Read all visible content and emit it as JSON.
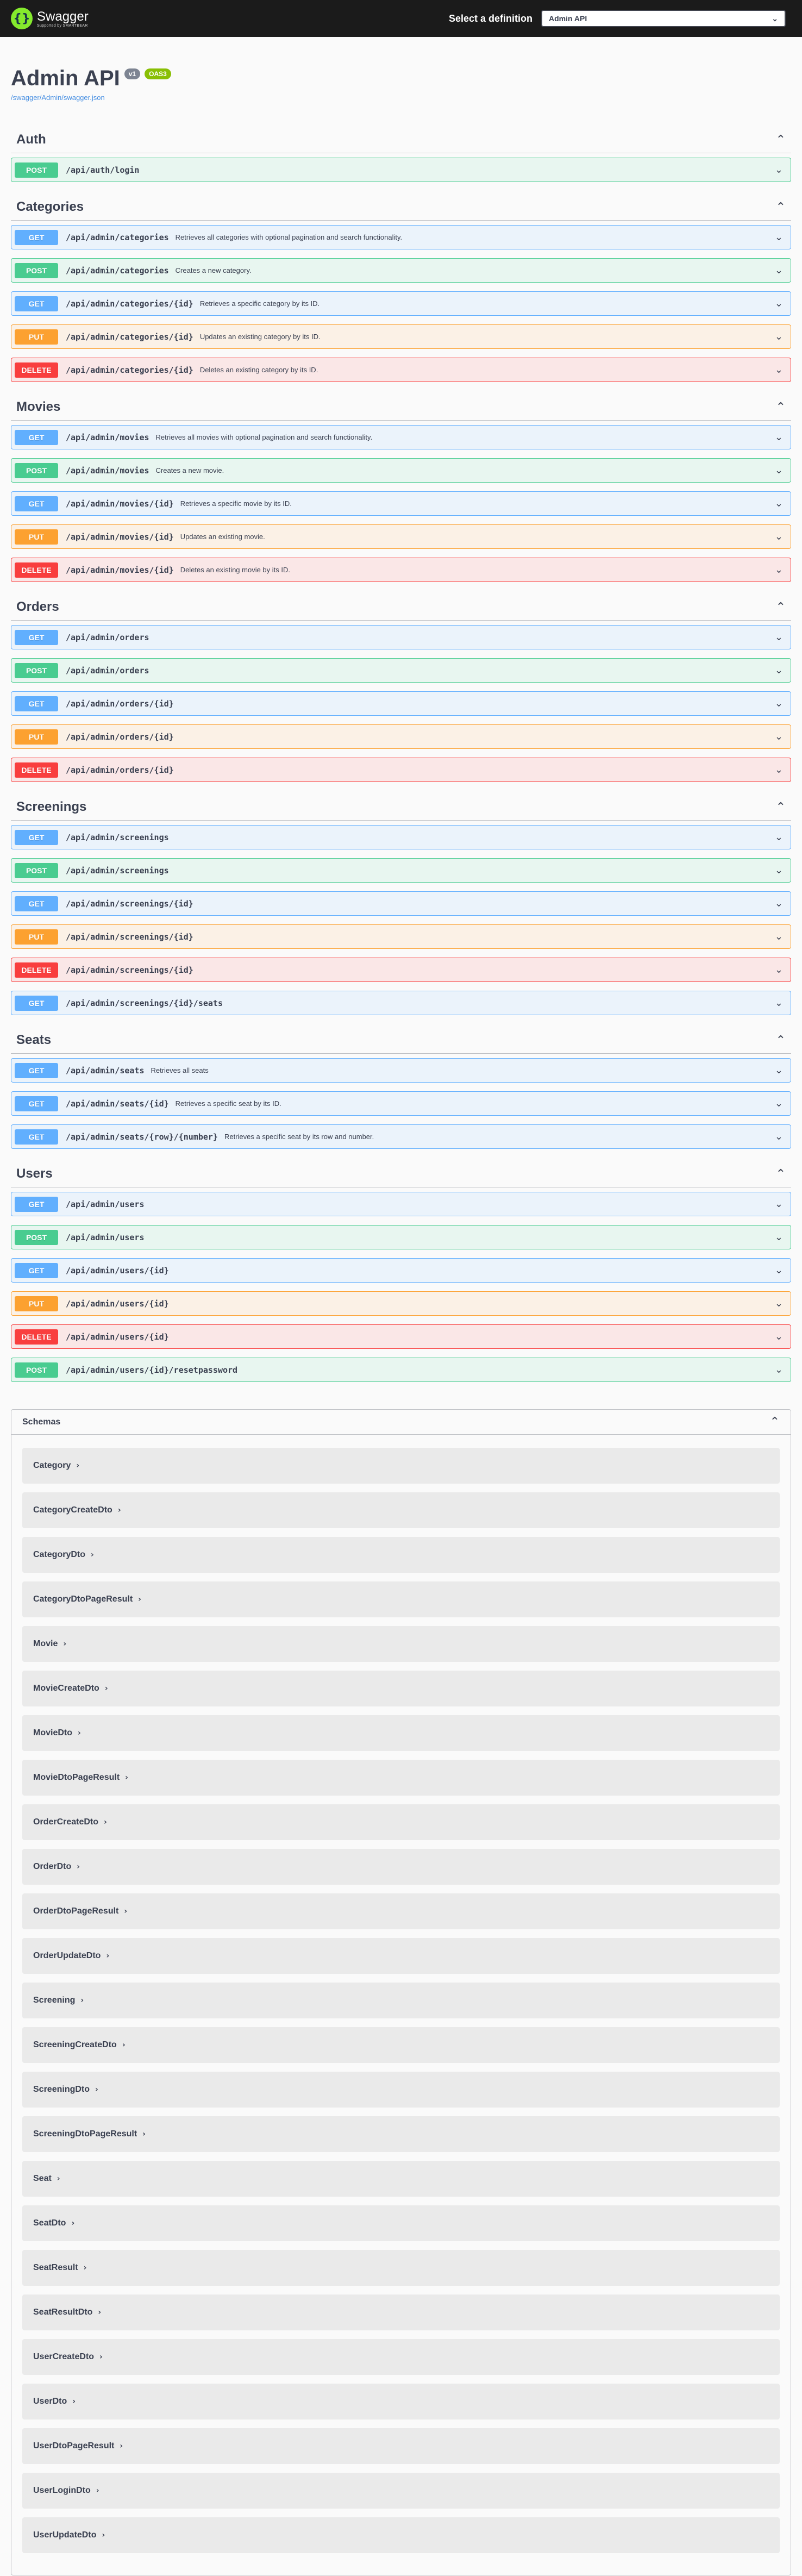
{
  "topbar": {
    "logo_name": "Swagger",
    "logo_sub": "Supported by SMARTBEAR",
    "definition_label": "Select a definition",
    "definition_value": "Admin API"
  },
  "info": {
    "title": "Admin API",
    "version": "v1",
    "oas": "OAS3",
    "url": "/swagger/Admin/swagger.json"
  },
  "tags": [
    {
      "name": "Auth",
      "ops": [
        {
          "method": "POST",
          "cls": "post",
          "path": "/api/auth/login",
          "summary": ""
        }
      ]
    },
    {
      "name": "Categories",
      "ops": [
        {
          "method": "GET",
          "cls": "get",
          "path": "/api/admin/categories",
          "summary": "Retrieves all categories with optional pagination and search functionality."
        },
        {
          "method": "POST",
          "cls": "post",
          "path": "/api/admin/categories",
          "summary": "Creates a new category."
        },
        {
          "method": "GET",
          "cls": "get",
          "path": "/api/admin/categories/{id}",
          "summary": "Retrieves a specific category by its ID."
        },
        {
          "method": "PUT",
          "cls": "put",
          "path": "/api/admin/categories/{id}",
          "summary": "Updates an existing category by its ID."
        },
        {
          "method": "DELETE",
          "cls": "delete",
          "path": "/api/admin/categories/{id}",
          "summary": "Deletes an existing category by its ID."
        }
      ]
    },
    {
      "name": "Movies",
      "ops": [
        {
          "method": "GET",
          "cls": "get",
          "path": "/api/admin/movies",
          "summary": "Retrieves all movies with optional pagination and search functionality."
        },
        {
          "method": "POST",
          "cls": "post",
          "path": "/api/admin/movies",
          "summary": "Creates a new movie."
        },
        {
          "method": "GET",
          "cls": "get",
          "path": "/api/admin/movies/{id}",
          "summary": "Retrieves a specific movie by its ID."
        },
        {
          "method": "PUT",
          "cls": "put",
          "path": "/api/admin/movies/{id}",
          "summary": "Updates an existing movie."
        },
        {
          "method": "DELETE",
          "cls": "delete",
          "path": "/api/admin/movies/{id}",
          "summary": "Deletes an existing movie by its ID."
        }
      ]
    },
    {
      "name": "Orders",
      "ops": [
        {
          "method": "GET",
          "cls": "get",
          "path": "/api/admin/orders",
          "summary": ""
        },
        {
          "method": "POST",
          "cls": "post",
          "path": "/api/admin/orders",
          "summary": ""
        },
        {
          "method": "GET",
          "cls": "get",
          "path": "/api/admin/orders/{id}",
          "summary": ""
        },
        {
          "method": "PUT",
          "cls": "put",
          "path": "/api/admin/orders/{id}",
          "summary": ""
        },
        {
          "method": "DELETE",
          "cls": "delete",
          "path": "/api/admin/orders/{id}",
          "summary": ""
        }
      ]
    },
    {
      "name": "Screenings",
      "ops": [
        {
          "method": "GET",
          "cls": "get",
          "path": "/api/admin/screenings",
          "summary": ""
        },
        {
          "method": "POST",
          "cls": "post",
          "path": "/api/admin/screenings",
          "summary": ""
        },
        {
          "method": "GET",
          "cls": "get",
          "path": "/api/admin/screenings/{id}",
          "summary": ""
        },
        {
          "method": "PUT",
          "cls": "put",
          "path": "/api/admin/screenings/{id}",
          "summary": ""
        },
        {
          "method": "DELETE",
          "cls": "delete",
          "path": "/api/admin/screenings/{id}",
          "summary": ""
        },
        {
          "method": "GET",
          "cls": "get",
          "path": "/api/admin/screenings/{id}/seats",
          "summary": ""
        }
      ]
    },
    {
      "name": "Seats",
      "ops": [
        {
          "method": "GET",
          "cls": "get",
          "path": "/api/admin/seats",
          "summary": "Retrieves all seats"
        },
        {
          "method": "GET",
          "cls": "get",
          "path": "/api/admin/seats/{id}",
          "summary": "Retrieves a specific seat by its ID."
        },
        {
          "method": "GET",
          "cls": "get",
          "path": "/api/admin/seats/{row}/{number}",
          "summary": "Retrieves a specific seat by its row and number."
        }
      ]
    },
    {
      "name": "Users",
      "ops": [
        {
          "method": "GET",
          "cls": "get",
          "path": "/api/admin/users",
          "summary": ""
        },
        {
          "method": "POST",
          "cls": "post",
          "path": "/api/admin/users",
          "summary": ""
        },
        {
          "method": "GET",
          "cls": "get",
          "path": "/api/admin/users/{id}",
          "summary": ""
        },
        {
          "method": "PUT",
          "cls": "put",
          "path": "/api/admin/users/{id}",
          "summary": ""
        },
        {
          "method": "DELETE",
          "cls": "delete",
          "path": "/api/admin/users/{id}",
          "summary": ""
        },
        {
          "method": "POST",
          "cls": "post",
          "path": "/api/admin/users/{id}/resetpassword",
          "summary": ""
        }
      ]
    }
  ],
  "schemas": {
    "title": "Schemas",
    "models": [
      "Category",
      "CategoryCreateDto",
      "CategoryDto",
      "CategoryDtoPageResult",
      "Movie",
      "MovieCreateDto",
      "MovieDto",
      "MovieDtoPageResult",
      "OrderCreateDto",
      "OrderDto",
      "OrderDtoPageResult",
      "OrderUpdateDto",
      "Screening",
      "ScreeningCreateDto",
      "ScreeningDto",
      "ScreeningDtoPageResult",
      "Seat",
      "SeatDto",
      "SeatResult",
      "SeatResultDto",
      "UserCreateDto",
      "UserDto",
      "UserDtoPageResult",
      "UserLoginDto",
      "UserUpdateDto"
    ]
  },
  "colors": {
    "get": "#61affe",
    "post": "#49cc90",
    "put": "#fca130",
    "delete": "#f93e3e",
    "topbar": "#1b1b1b",
    "logo": "#85ea2d"
  },
  "icons": {
    "logo": "swagger-logo-icon",
    "expand": "chevron-down-icon",
    "collapse": "chevron-up-icon",
    "model": "chevron-right-icon"
  }
}
